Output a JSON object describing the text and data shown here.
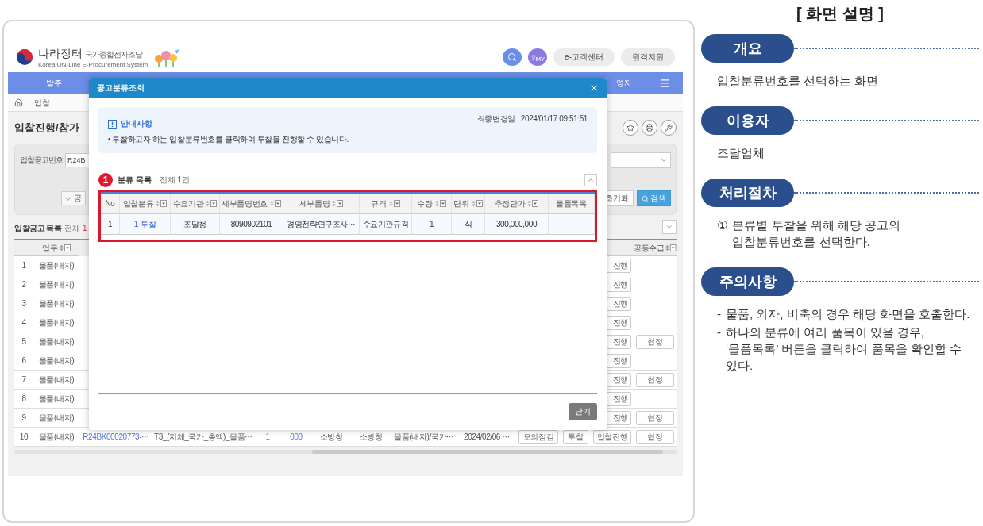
{
  "app": {
    "header": {
      "logo_title": "나라장터",
      "logo_subtitle": "국가종합전자조달",
      "logo_english": "Korea ON-Line E-Procurement System",
      "user_badge": "MY",
      "buttons": [
        "e-고객센터",
        "원격지원"
      ]
    },
    "nav": {
      "left": "발주",
      "right": "영자"
    },
    "breadcrumb": "입찰",
    "page_title": "입찰진행/참가",
    "search": {
      "label": "입찰공고번호",
      "value": "R24B",
      "check_label": "공",
      "reset": "초기화",
      "submit": "검색"
    },
    "list": {
      "title": "입찰공고 목록",
      "count_label": "전체 ",
      "count": "1",
      "left_column": "업무",
      "right_column": "공동수급",
      "rows": [
        {
          "no": "1",
          "work": "물품(내자)",
          "progress": "진행"
        },
        {
          "no": "2",
          "work": "물품(내자)",
          "progress": "진행"
        },
        {
          "no": "3",
          "work": "물품(내자)",
          "progress": "진행"
        },
        {
          "no": "4",
          "work": "물품(내자)",
          "progress": "진행"
        },
        {
          "no": "5",
          "work": "물품(내자)",
          "progress": "진행",
          "agreement": "협정"
        },
        {
          "no": "6",
          "work": "물품(내자)",
          "progress": "진행"
        },
        {
          "no": "7",
          "work": "물품(내자)",
          "progress": "진행",
          "agreement": "협정"
        },
        {
          "no": "8",
          "work": "물품(내자)",
          "progress": "진행"
        },
        {
          "no": "9",
          "work": "물품(내자)",
          "progress": "진행",
          "agreement": "협정"
        },
        {
          "no": "10",
          "work": "물품(내자)",
          "progress": "입찰진행",
          "agreement": "협정",
          "cells": [
            {
              "text": "R24BK00020773-⋯",
              "kind": "link"
            },
            {
              "text": "T3_(지체_국가_총액)_물품⋯",
              "kind": "text"
            },
            {
              "text": "1",
              "kind": "link"
            },
            {
              "text": "000",
              "kind": "link"
            },
            {
              "text": "소방청",
              "kind": "text"
            },
            {
              "text": "소방청",
              "kind": "text"
            },
            {
              "text": "물품(내자)/국가⋯",
              "kind": "text"
            },
            {
              "text": "2024/02/06 ⋯",
              "kind": "text"
            },
            {
              "text": "모의점검",
              "kind": "button"
            },
            {
              "text": "투찰",
              "kind": "button"
            }
          ]
        }
      ]
    }
  },
  "dialog": {
    "title": "공고분류조회",
    "notice": {
      "title": "안내사항",
      "updated": "최종변경일 : 2024/01/17 09:51:51",
      "bullets": [
        "• 투찰하고자 하는 입찰분류번호를 클릭하여 투찰을 진행할 수 있습니다."
      ]
    },
    "annotation": "1",
    "list_title": "분류 목록",
    "count_label": "전체 ",
    "count": "1",
    "count_unit": "건",
    "columns": [
      {
        "label": "No",
        "sortable": false
      },
      {
        "label": "입찰분류",
        "sortable": true
      },
      {
        "label": "수요기관",
        "sortable": true
      },
      {
        "label": "세부품명번호",
        "sortable": true
      },
      {
        "label": "세부품명",
        "sortable": true
      },
      {
        "label": "규격",
        "sortable": true
      },
      {
        "label": "수량",
        "sortable": true
      },
      {
        "label": "단위",
        "sortable": true
      },
      {
        "label": "추정단가",
        "sortable": true
      },
      {
        "label": "물품목록",
        "sortable": false
      }
    ],
    "rows": [
      {
        "cells": [
          {
            "text": "1",
            "kind": "text"
          },
          {
            "text": "1-투찰",
            "kind": "link"
          },
          {
            "text": "조달청",
            "kind": "text"
          },
          {
            "text": "8090902101",
            "kind": "text"
          },
          {
            "text": "경영전략연구조사⋯",
            "kind": "text"
          },
          {
            "text": "수요기관규격",
            "kind": "text"
          },
          {
            "text": "1",
            "kind": "text"
          },
          {
            "text": "식",
            "kind": "text"
          },
          {
            "text": "300,000,000",
            "kind": "text"
          }
        ]
      }
    ],
    "close": "닫기"
  },
  "explanation": {
    "title": "[ 화면 설명 ]",
    "sections": [
      {
        "label": "개요",
        "items": [
          {
            "text": "입찰분류번호를 선택하는 화면"
          }
        ]
      },
      {
        "label": "이용자",
        "items": [
          {
            "text": "조달업체"
          }
        ]
      },
      {
        "label": "처리절차",
        "items": [
          {
            "marker": "①",
            "text": "분류별 투찰을 위해 해당 공고의 입찰분류번호를 선택한다."
          }
        ]
      },
      {
        "label": "주의사항",
        "items": [
          {
            "marker": "-",
            "text": "물품, 외자, 비축의 경우 해당 화면을 호출한다."
          },
          {
            "marker": "-",
            "text": "하나의 분류에 여러 품목이 있을 경우, ‘물품목록’ 버튼을 클릭하여 품목을 확인할 수 있다."
          }
        ]
      }
    ]
  }
}
